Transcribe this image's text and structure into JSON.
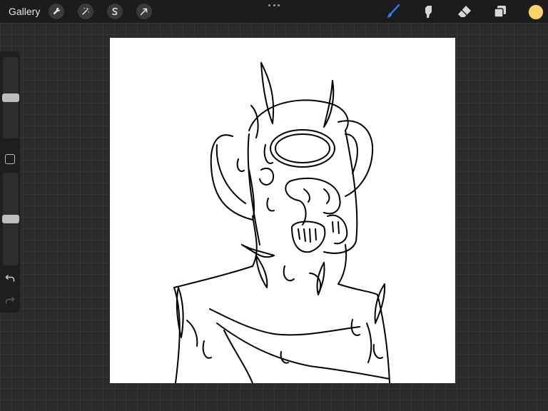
{
  "topbar": {
    "gallery_label": "Gallery",
    "left_tools": [
      {
        "name": "actions",
        "icon": "wrench-icon"
      },
      {
        "name": "adjustments",
        "icon": "magic-wand-icon"
      },
      {
        "name": "selection",
        "icon": "selection-s-icon"
      },
      {
        "name": "transform",
        "icon": "arrow-cursor-icon"
      }
    ],
    "more_icon": "more-dots-icon",
    "right_tools": [
      {
        "name": "brush",
        "icon": "brush-icon",
        "active": true
      },
      {
        "name": "smudge",
        "icon": "smudge-icon",
        "active": false
      },
      {
        "name": "eraser",
        "icon": "eraser-icon",
        "active": false
      },
      {
        "name": "layers",
        "icon": "layers-icon",
        "active": false
      }
    ],
    "current_color": "#f9d369",
    "active_tool_color": "#2f80ed"
  },
  "sidebar": {
    "brush_size_level": 0.5,
    "opacity_level": 0.5,
    "modifier_icon": "square-modifier-icon",
    "undo_icon": "undo-icon",
    "redo_icon": "redo-icon"
  },
  "canvas": {
    "background": "#ffffff",
    "content": "line-art-drawing"
  }
}
